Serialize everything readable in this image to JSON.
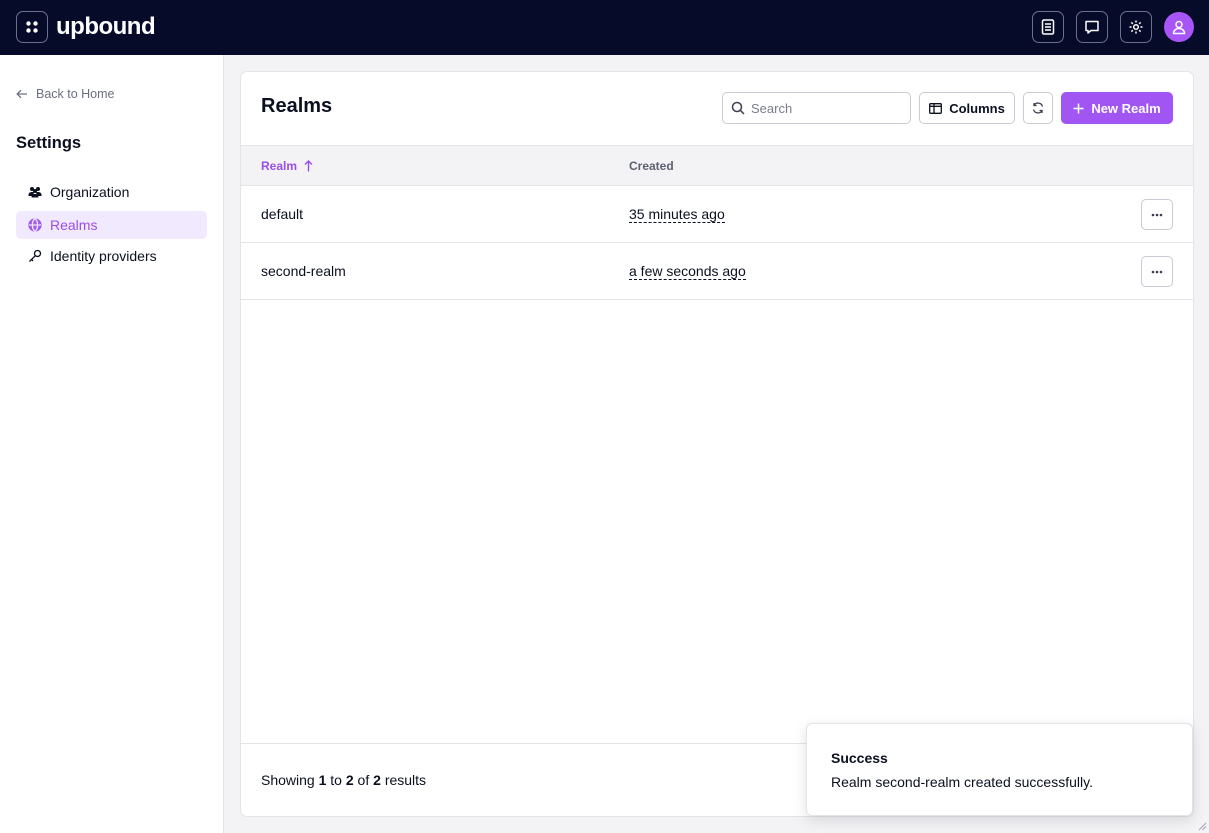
{
  "brand": {
    "name": "upbound"
  },
  "header": {
    "icons": [
      "docs-icon",
      "feedback-icon",
      "settings-gear-icon",
      "user-avatar-icon"
    ]
  },
  "sidebar": {
    "back_label": "Back to Home",
    "section_title": "Settings",
    "items": [
      {
        "label": "Organization",
        "icon": "people-icon",
        "active": false
      },
      {
        "label": "Realms",
        "icon": "globe-icon",
        "active": true
      },
      {
        "label": "Identity providers",
        "icon": "key-icon",
        "active": false
      }
    ]
  },
  "main": {
    "title": "Realms",
    "search_placeholder": "Search",
    "columns_label": "Columns",
    "new_label": "New Realm",
    "table": {
      "headers": {
        "realm": "Realm",
        "created": "Created"
      },
      "sort": {
        "column": "Realm",
        "direction": "ascending"
      },
      "rows": [
        {
          "name": "default",
          "created": "35 minutes ago"
        },
        {
          "name": "second-realm",
          "created": "a few seconds ago"
        }
      ]
    },
    "footer": {
      "showing_prefix": "Showing",
      "from": "1",
      "to_word": "to",
      "to": "2",
      "of_word": "of",
      "total": "2",
      "suffix": "results"
    }
  },
  "toast": {
    "title": "Success",
    "message": "Realm second-realm created successfully."
  },
  "colors": {
    "topbar": "#060b2a",
    "accent": "#a155f3",
    "active_bg": "#f1eafe",
    "active_text": "#9b4de8"
  }
}
